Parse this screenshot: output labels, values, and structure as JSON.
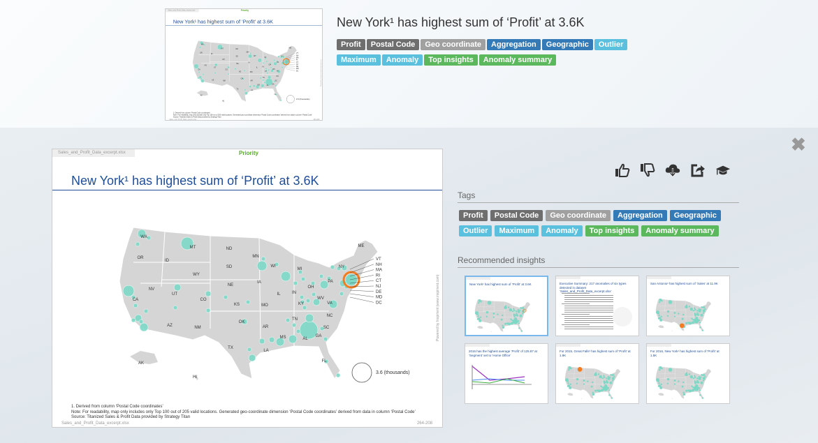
{
  "header": {
    "title": "New York¹ has highest sum of ‘Profit’ at 3.6K",
    "tags": [
      {
        "label": "Profit",
        "color": "#6e6e6e"
      },
      {
        "label": "Postal Code",
        "color": "#6e6e6e"
      },
      {
        "label": "Geo coordinate",
        "color": "#a0a0a0"
      },
      {
        "label": "Aggregation",
        "color": "#337ab7"
      },
      {
        "label": "Geographic",
        "color": "#337ab7"
      },
      {
        "label": "Outlier",
        "color": "#5bc0de"
      },
      {
        "label": "Maximum",
        "color": "#5bc0de"
      },
      {
        "label": "Anomaly",
        "color": "#5bc0de"
      },
      {
        "label": "Top insights",
        "color": "#5cb85c"
      },
      {
        "label": "Anomaly summary",
        "color": "#5cb85c"
      }
    ]
  },
  "slide": {
    "file": "Sales_and_Profit_Data_excerpt.xlsx",
    "priority": "Priority",
    "title": "New York¹ has highest sum of ‘Profit’ at 3.6K",
    "note1": "1. Derived from column ‘Postal Code coordinates’",
    "note2": "Note: For readability, map only includes only Top 100 out of 205 valid locations.   Generated geo-coordinate dimension ‘Postal Code coordinates’ derived from data in column ‘Postal Code’",
    "note3": "Source: Titanized Sales & Profit Data provided by Strategy Titan",
    "footer_file": "Sales_and_Profit_Data_excerpt.xlsx",
    "page": "264-208",
    "side_text": "Powered by Inspirient (www.inspirient.com)",
    "legend": "3.6 (thousands)",
    "bubble_color": "#7dd8c6",
    "highlight_color": "#f47c20",
    "state_labels": [
      "WA",
      "OR",
      "MT",
      "ID",
      "WY",
      "ND",
      "SD",
      "NE",
      "MN",
      "WI",
      "IA",
      "IL",
      "IN",
      "OH",
      "MI",
      "PA",
      "NY",
      "ME",
      "NV",
      "CA",
      "UT",
      "CO",
      "KS",
      "MO",
      "KY",
      "WV",
      "VA",
      "NC",
      "TN",
      "AR",
      "OK",
      "AZ",
      "NM",
      "TX",
      "LA",
      "MS",
      "AL",
      "GA",
      "SC",
      "FL",
      "AK",
      "HI"
    ],
    "east_labels": [
      "VT",
      "NH",
      "MA",
      "RI",
      "CT",
      "NJ",
      "DE",
      "MD",
      "DC"
    ]
  },
  "actions": {
    "like": "thumbs-up-icon",
    "dislike": "thumbs-down-icon",
    "download": "cloud-download-icon",
    "share": "share-icon",
    "learn": "graduation-cap-icon",
    "close": "✖"
  },
  "tags_section": {
    "heading": "Tags"
  },
  "recommended": {
    "heading": "Recommended insights",
    "items": [
      {
        "title": "New York¹ has highest sum of ‘Profit’ at 3.6K",
        "kind": "map"
      },
      {
        "title": "Executive Summary: 217 anomalies of six types detected in dataset ‘Sales_and_Profit_Data_excerpt.xlsx’",
        "kind": "text"
      },
      {
        "title": "San Antonio¹ has highest sum of ‘Sales’ at 11.9K",
        "kind": "map"
      },
      {
        "title": "2016 has the highest average ‘Profit’ of 125.87 at ‘Segment’ set to ‘Home Office’",
        "kind": "line"
      },
      {
        "title": "For 2015, Great Falls¹ has highest sum of ‘Profit’ at 1.9K",
        "kind": "map"
      },
      {
        "title": "For 2016, New York¹ has highest sum of ‘Profit’ at 1.5K",
        "kind": "map"
      }
    ]
  }
}
